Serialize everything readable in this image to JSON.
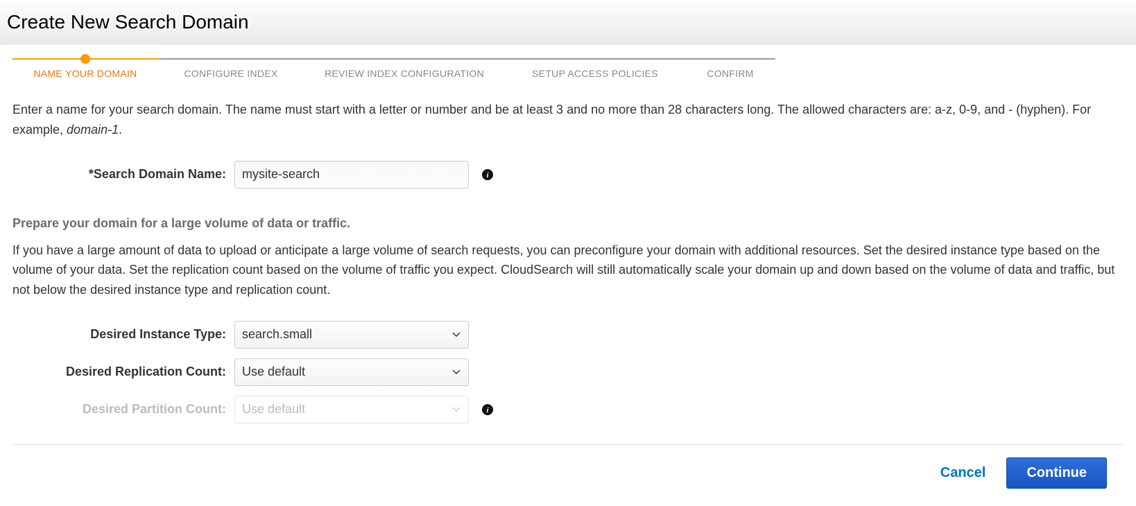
{
  "header": {
    "title": "Create New Search Domain"
  },
  "wizard": {
    "steps": [
      {
        "label": "NAME YOUR DOMAIN",
        "active": true
      },
      {
        "label": "CONFIGURE INDEX",
        "active": false
      },
      {
        "label": "REVIEW INDEX CONFIGURATION",
        "active": false
      },
      {
        "label": "SETUP ACCESS POLICIES",
        "active": false
      },
      {
        "label": "CONFIRM",
        "active": false
      }
    ]
  },
  "intro": {
    "text_a": "Enter a name for your search domain. The name must start with a letter or number and be at least 3 and no more than 28 characters long. The allowed characters are: a-z, 0-9, and - (hyphen). For example, ",
    "example": "domain-1",
    "text_b": "."
  },
  "fields": {
    "domain_name": {
      "label": "*Search Domain Name:",
      "value": "mysite-search"
    }
  },
  "scaling": {
    "heading": "Prepare your domain for a large volume of data or traffic.",
    "body": "If you have a large amount of data to upload or anticipate a large volume of search requests, you can preconfigure your domain with additional resources. Set the desired instance type based on the volume of your data. Set the replication count based on the volume of traffic you expect. CloudSearch will still automatically scale your domain up and down based on the volume of data and traffic, but not below the desired instance type and replication count.",
    "instance_type": {
      "label": "Desired Instance Type:",
      "value": "search.small"
    },
    "replication_count": {
      "label": "Desired Replication Count:",
      "value": "Use default"
    },
    "partition_count": {
      "label": "Desired Partition Count:",
      "value": "Use default"
    }
  },
  "footer": {
    "cancel": "Cancel",
    "continue": "Continue"
  }
}
